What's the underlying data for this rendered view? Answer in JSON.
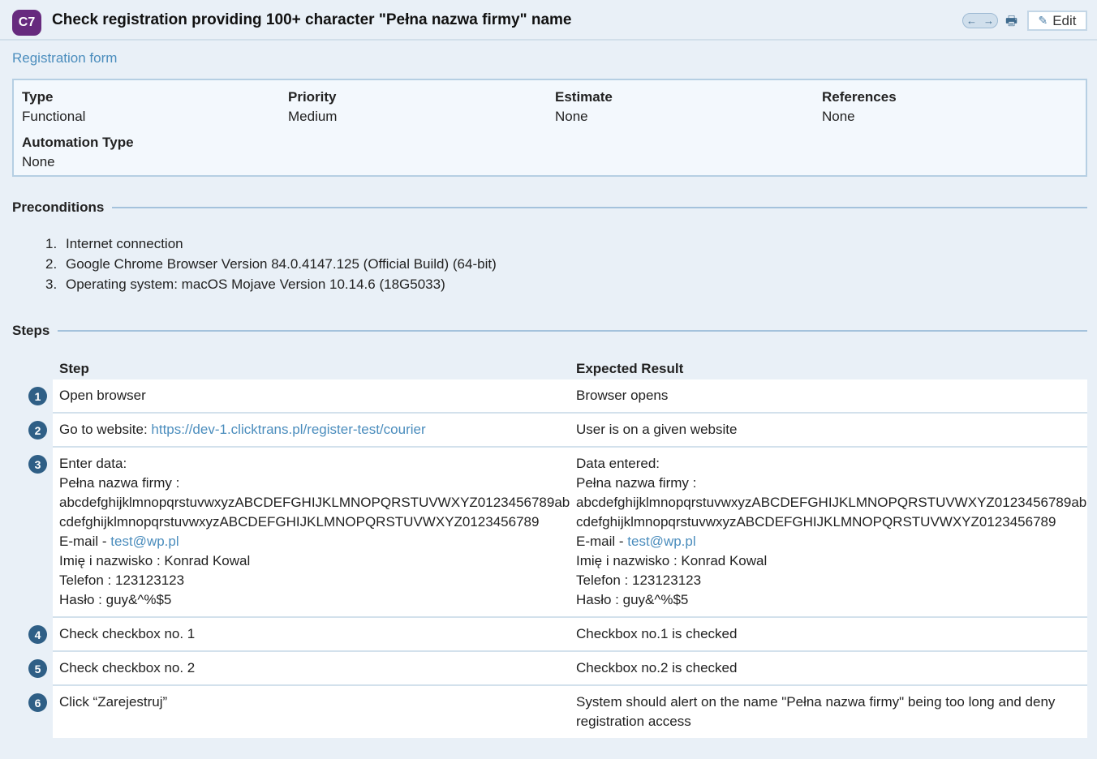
{
  "header": {
    "id": "C7",
    "title": "Check registration providing 100+ character \"Pełna nazwa firmy\" name",
    "nav_prev": "←",
    "nav_next": "→",
    "print_icon": "printer-icon",
    "edit_label": "Edit"
  },
  "section": "Registration form",
  "fields": [
    {
      "label": "Type",
      "value": "Functional"
    },
    {
      "label": "Priority",
      "value": "Medium"
    },
    {
      "label": "Estimate",
      "value": "None"
    },
    {
      "label": "References",
      "value": "None"
    },
    {
      "label": "Automation Type",
      "value": "None"
    }
  ],
  "preconditions": {
    "title": "Preconditions",
    "items": [
      "Internet connection",
      "Google Chrome Browser Version 84.0.4147.125 (Official Build) (64-bit)",
      "Operating system: macOS Mojave Version 10.14.6 (18G5033)"
    ]
  },
  "steps": {
    "title": "Steps",
    "col_step": "Step",
    "col_expected": "Expected Result",
    "rows": [
      {
        "n": "1",
        "step": [
          "Open browser"
        ],
        "expected": [
          "Browser opens"
        ]
      },
      {
        "n": "2",
        "step_prefix": "Go to website: ",
        "step_link": "https://dev-1.clicktrans.pl/register-test/courier",
        "expected": [
          "User is on a given website"
        ]
      },
      {
        "n": "3",
        "step_intro": "Enter data:",
        "expected_intro": "Data entered:",
        "name_label": "Pełna nazwa firmy :",
        "name_line1": "abcdefghijklmnopqrstuvwxyzABCDEFGHIJKLMNOPQRSTUVWXYZ0123456789ab",
        "name_line2": "cdefghijklmnopqrstuvwxyzABCDEFGHIJKLMNOPQRSTUVWXYZ0123456789",
        "email_label": "E-mail - ",
        "email": "test@wp.pl",
        "fullname": "Imię i nazwisko : Konrad Kowal",
        "phone": "Telefon : 123123123",
        "password": "Hasło : guy&^%$5"
      },
      {
        "n": "4",
        "step": [
          "Check checkbox no. 1"
        ],
        "expected": [
          "Checkbox no.1 is checked"
        ]
      },
      {
        "n": "5",
        "step": [
          "Check checkbox no. 2"
        ],
        "expected": [
          "Checkbox no.2 is checked"
        ]
      },
      {
        "n": "6",
        "step": [
          "Click “Zarejestruj”"
        ],
        "expected": [
          "System should alert on the name \"Pełna nazwa firmy\" being too long and deny registration access"
        ]
      }
    ]
  }
}
